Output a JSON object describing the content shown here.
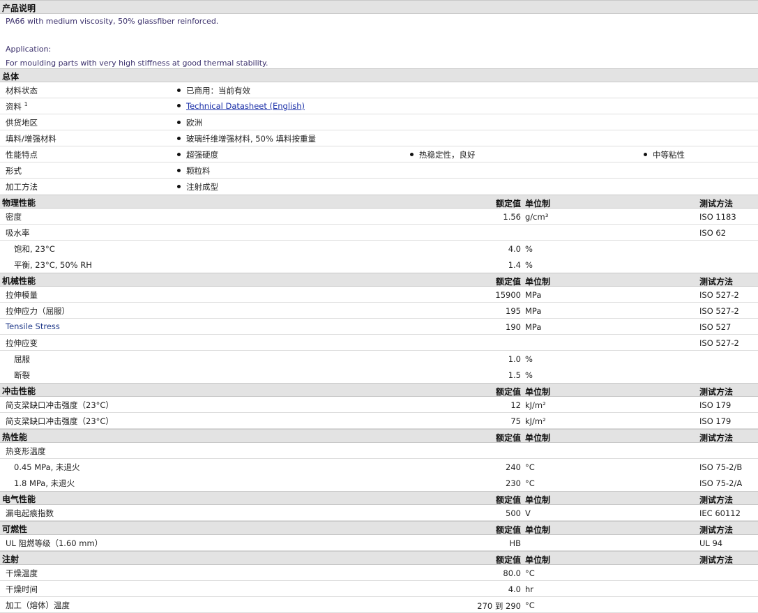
{
  "description": {
    "title": "产品说明",
    "line1": "PA66 with medium viscosity, 50% glassfiber reinforced.",
    "line2": "Application:",
    "line3": "For moulding parts with very high stiffness at good thermal stability."
  },
  "general": {
    "title": "总体",
    "rows": [
      {
        "label": "材料状态",
        "value": "已商用：当前有效"
      },
      {
        "label": "资料",
        "sup": "1",
        "link": "Technical Datasheet (English)"
      },
      {
        "label": "供货地区",
        "value": "欧洲"
      },
      {
        "label": "填料/增强材料",
        "value": "玻璃纤维增强材料, 50% 填料按重量"
      },
      {
        "label": "性能特点",
        "values": [
          "超强硬度",
          "热稳定性，良好",
          "中等粘性"
        ]
      },
      {
        "label": "形式",
        "value": "颗粒料"
      },
      {
        "label": "加工方法",
        "value": "注射成型"
      }
    ]
  },
  "columns": {
    "nominal": "额定值",
    "unit": "单位制",
    "method": "测试方法"
  },
  "sections": [
    {
      "title": "物理性能",
      "rows": [
        {
          "label": "密度",
          "value": "1.56",
          "unit": "g/cm³",
          "method": "ISO 1183"
        },
        {
          "label": "吸水率",
          "value": "",
          "unit": "",
          "method": "ISO 62"
        },
        {
          "label": "饱和, 23°C",
          "value": "4.0",
          "unit": "%",
          "method": "",
          "sub": true
        },
        {
          "label": "平衡, 23°C, 50% RH",
          "value": "1.4",
          "unit": "%",
          "method": "",
          "sub": true
        }
      ]
    },
    {
      "title": "机械性能",
      "rows": [
        {
          "label": "拉伸模量",
          "value": "15900",
          "unit": "MPa",
          "method": "ISO 527-2"
        },
        {
          "label": "拉伸应力（屈服）",
          "value": "195",
          "unit": "MPa",
          "method": "ISO 527-2"
        },
        {
          "label": "Tensile Stress",
          "value": "190",
          "unit": "MPa",
          "method": "ISO 527",
          "blue": true
        },
        {
          "label": "拉伸应变",
          "value": "",
          "unit": "",
          "method": "ISO 527-2"
        },
        {
          "label": "屈服",
          "value": "1.0",
          "unit": "%",
          "method": "",
          "sub": true
        },
        {
          "label": "断裂",
          "value": "1.5",
          "unit": "%",
          "method": "",
          "sub": true
        }
      ]
    },
    {
      "title": "冲击性能",
      "rows": [
        {
          "label": "简支梁缺口冲击强度（23°C）",
          "value": "12",
          "unit": "kJ/m²",
          "method": "ISO 179"
        },
        {
          "label": "简支梁缺口冲击强度（23°C）",
          "value": "75",
          "unit": "kJ/m²",
          "method": "ISO 179"
        }
      ]
    },
    {
      "title": "热性能",
      "rows": [
        {
          "label": "热变形温度",
          "value": "",
          "unit": "",
          "method": ""
        },
        {
          "label": "0.45 MPa, 未退火",
          "value": "240",
          "unit": "°C",
          "method": "ISO 75-2/B",
          "sub": true
        },
        {
          "label": "1.8 MPa, 未退火",
          "value": "230",
          "unit": "°C",
          "method": "ISO 75-2/A",
          "sub": true
        }
      ]
    },
    {
      "title": "电气性能",
      "rows": [
        {
          "label": "漏电起痕指数",
          "value": "500",
          "unit": "V",
          "method": "IEC 60112"
        }
      ]
    },
    {
      "title": "可燃性",
      "rows": [
        {
          "label": "UL 阻燃等级（1.60 mm）",
          "value": "HB",
          "unit": "",
          "method": "UL 94"
        }
      ]
    },
    {
      "title": "注射",
      "rows": [
        {
          "label": "干燥温度",
          "value": "80.0",
          "unit": "°C",
          "method": ""
        },
        {
          "label": "干燥时间",
          "value": "4.0",
          "unit": "hr",
          "method": ""
        },
        {
          "label": "加工（熔体）温度",
          "value": "270 到 290",
          "unit": "°C",
          "method": ""
        }
      ]
    }
  ]
}
